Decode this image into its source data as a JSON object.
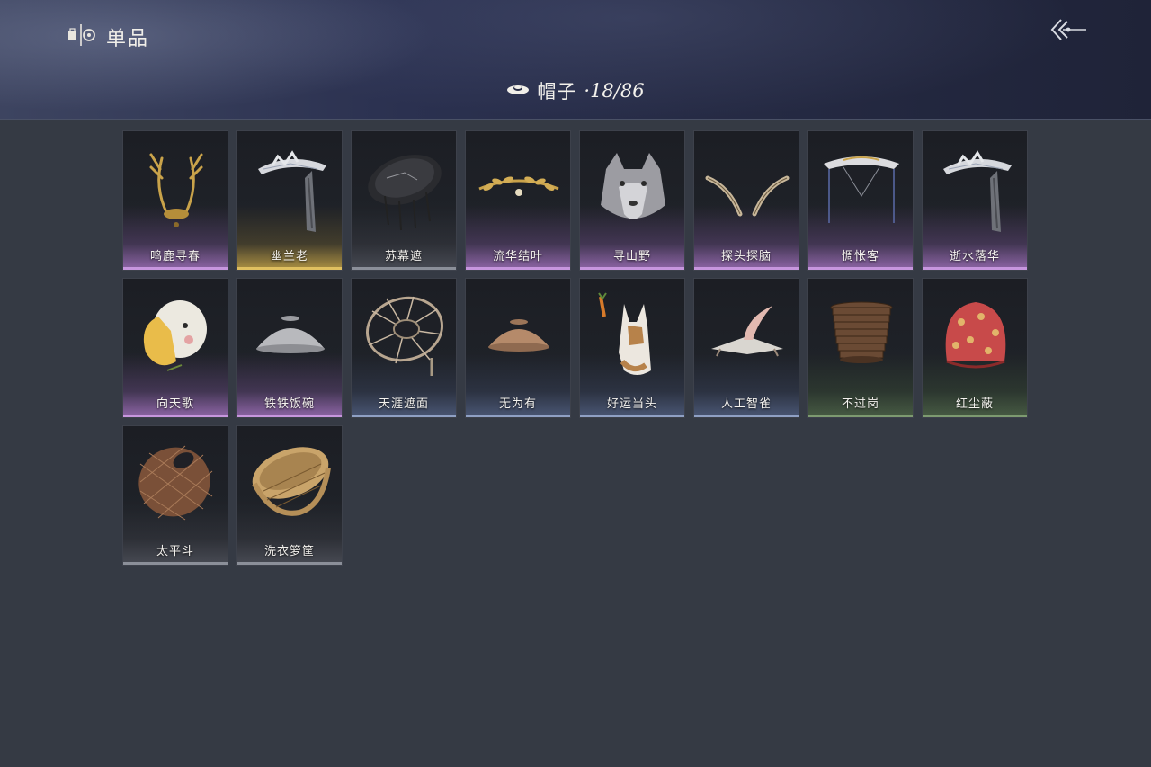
{
  "header": {
    "title": "单品",
    "icon": "wardrobe-icon",
    "back_icon": "back-arrow-icon"
  },
  "category": {
    "icon": "hat-icon",
    "name": "帽子",
    "count": "·18/86"
  },
  "rarity_colors": {
    "purple": "#c796de",
    "gold": "#e0c060",
    "blue": "#8fa0c4",
    "green": "#7d9a70",
    "gray": "#8b8f99"
  },
  "items": [
    {
      "name": "鸣鹿寻春",
      "rarity": "purple",
      "icon": "antler-crown-icon"
    },
    {
      "name": "幽兰老",
      "rarity": "gold",
      "icon": "veiled-hat-icon"
    },
    {
      "name": "苏幕遮",
      "rarity": "gray",
      "icon": "black-round-hat-icon"
    },
    {
      "name": "流华结叶",
      "rarity": "purple",
      "icon": "golden-leaf-circlet-icon"
    },
    {
      "name": "寻山野",
      "rarity": "purple",
      "icon": "wolf-head-icon"
    },
    {
      "name": "探头探脑",
      "rarity": "purple",
      "icon": "feather-antennae-icon"
    },
    {
      "name": "惆怅客",
      "rarity": "purple",
      "icon": "wide-brim-hat-icon"
    },
    {
      "name": "逝水落华",
      "rarity": "purple",
      "icon": "veiled-hat-icon"
    },
    {
      "name": "向天歌",
      "rarity": "purple",
      "icon": "goose-hood-icon"
    },
    {
      "name": "铁铁饭碗",
      "rarity": "purple",
      "icon": "metal-bowl-icon"
    },
    {
      "name": "天涯遮面",
      "rarity": "blue",
      "icon": "umbrella-hat-icon"
    },
    {
      "name": "无为有",
      "rarity": "blue",
      "icon": "clay-bowl-icon"
    },
    {
      "name": "好运当头",
      "rarity": "blue",
      "icon": "horse-head-icon"
    },
    {
      "name": "人工智雀",
      "rarity": "blue",
      "icon": "bird-hat-icon"
    },
    {
      "name": "不过岗",
      "rarity": "green",
      "icon": "stacked-bowls-icon"
    },
    {
      "name": "红尘蔽",
      "rarity": "green",
      "icon": "red-cloth-hood-icon"
    },
    {
      "name": "太平斗",
      "rarity": "gray",
      "icon": "woven-basket-icon"
    },
    {
      "name": "洗衣箩筐",
      "rarity": "gray",
      "icon": "washing-basket-icon"
    }
  ]
}
